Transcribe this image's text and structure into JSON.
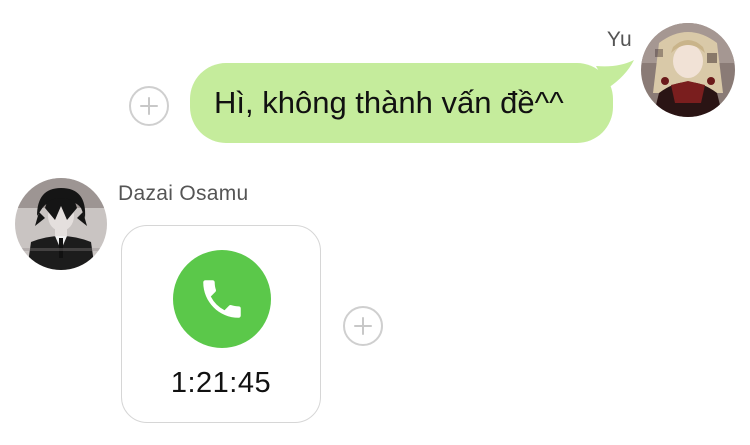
{
  "messages": [
    {
      "sender": "Yu",
      "direction": "outgoing",
      "text": "Hì, không thành vấn đề^^",
      "bubble_color": "#c5ec9c"
    },
    {
      "sender": "Dazai Osamu",
      "direction": "incoming",
      "type": "call",
      "call_duration": "1:21:45",
      "call_icon": "phone-icon",
      "call_icon_color": "#5bc84a"
    }
  ],
  "icons": {
    "add_reaction": "plus-circle-icon"
  }
}
